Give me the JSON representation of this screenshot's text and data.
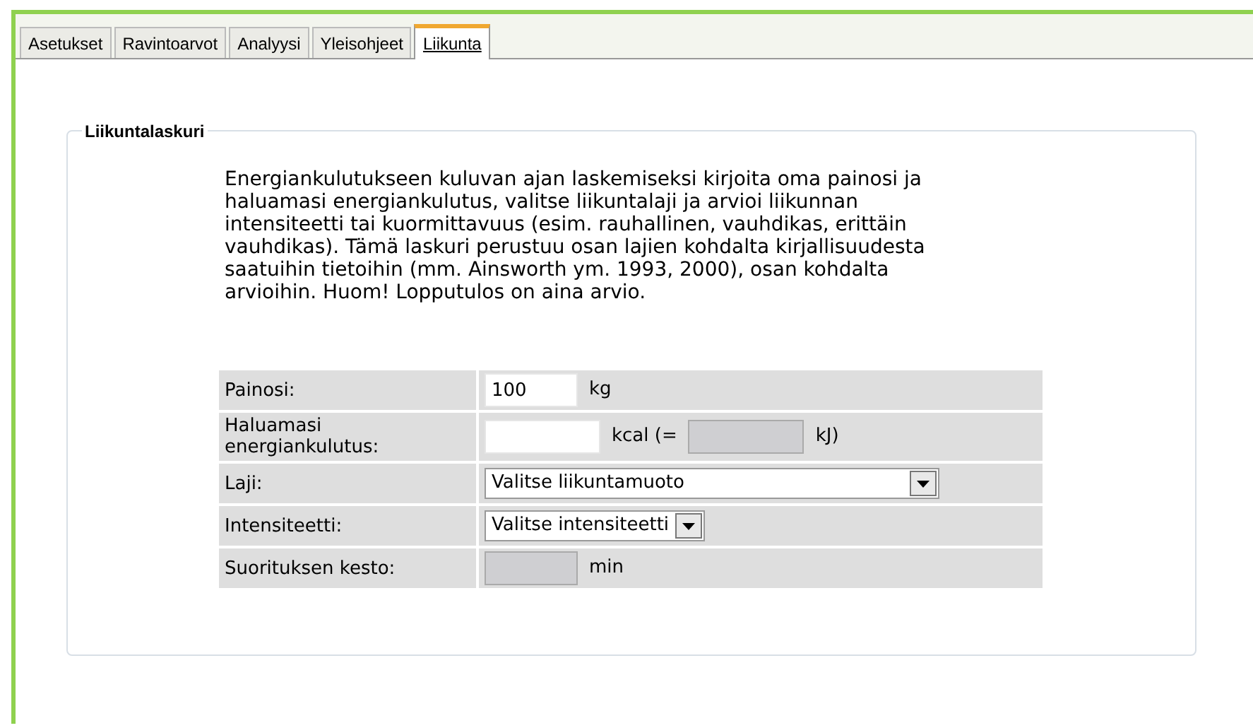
{
  "tabs": [
    {
      "label": "Asetukset",
      "selected": false
    },
    {
      "label": "Ravintoarvot",
      "selected": false
    },
    {
      "label": "Analyysi",
      "selected": false
    },
    {
      "label": "Yleisohjeet",
      "selected": false
    },
    {
      "label": "Liikunta",
      "selected": true
    }
  ],
  "calculator": {
    "title": "Liikuntalaskuri",
    "description": "Energiankulutukseen kuluvan ajan laskemiseksi kirjoita oma painosi ja haluamasi energiankulutus, valitse liikuntalaji ja arvioi liikunnan intensiteetti tai kuormittavuus (esim. rauhallinen, vauhdikas, erittäin vauhdikas). Tämä laskuri perustuu osan lajien kohdalta kirjallisuudesta saatuihin tietoihin (mm. Ainsworth ym. 1993, 2000), osan kohdalta arvioihin. Huom! Lopputulos on aina arvio.",
    "rows": [
      {
        "label": "Painosi:",
        "fields": [
          {
            "kind": "input",
            "value": "100",
            "disabled": false
          },
          {
            "kind": "text",
            "text": "kg"
          }
        ]
      },
      {
        "label": "Haluamasi energiankulutus:",
        "fields": [
          {
            "kind": "input",
            "disabled": false
          },
          {
            "kind": "text",
            "text": "kcal (="
          },
          {
            "kind": "input",
            "disabled": true
          },
          {
            "kind": "text",
            "text": "kJ)"
          }
        ]
      },
      {
        "label": "Laji:",
        "fields": [
          {
            "kind": "select",
            "value": "Valitse liikuntamuoto"
          }
        ]
      },
      {
        "label": "Intensiteetti:",
        "fields": [
          {
            "kind": "select",
            "value": "Valitse intensiteetti"
          }
        ]
      },
      {
        "label": "Suorituksen kesto:",
        "fields": [
          {
            "kind": "input",
            "disabled": true
          },
          {
            "kind": "text",
            "text": "min"
          }
        ]
      }
    ]
  }
}
